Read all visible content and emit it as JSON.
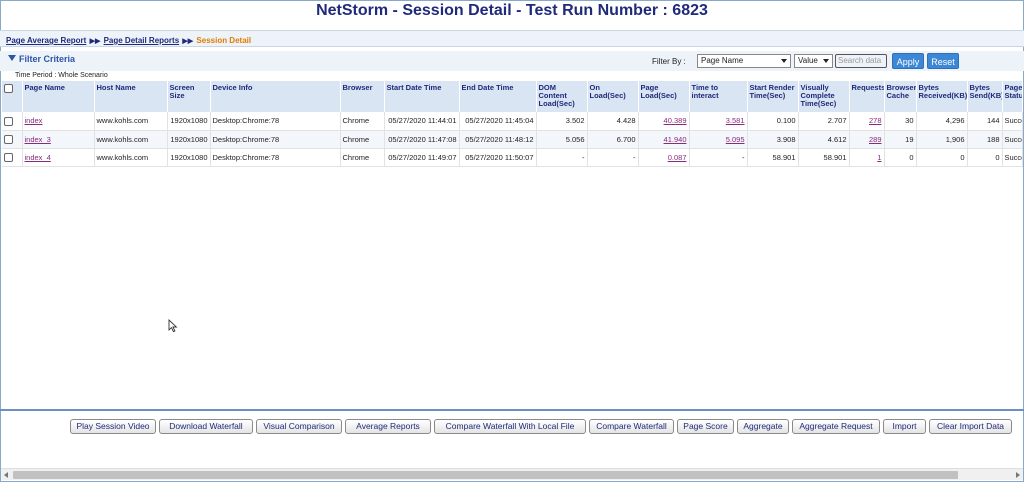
{
  "title": "NetStorm - Session Detail - Test Run Number : 6823",
  "breadcrumb": {
    "items": [
      "Page Average Report",
      "Page Detail Reports"
    ],
    "current": "Session Detail"
  },
  "filter": {
    "title": "Filter Criteria",
    "filter_by_label": "Filter By :",
    "field_select": "Page Name",
    "value_select": "Value",
    "search_placeholder": "Search data",
    "apply_label": "Apply",
    "reset_label": "Reset",
    "time_period": "Time Period : Whole Scenario"
  },
  "table": {
    "columns": [
      "Page Name",
      "Host Name",
      "Screen Size",
      "Device Info",
      "Browser",
      "Start Date Time",
      "End Date Time",
      "DOM Content Load(Sec)",
      "On Load(Sec)",
      "Page Load(Sec)",
      "Time to interact",
      "Start Render Time(Sec)",
      "Visually Complete Time(Sec)",
      "Requests",
      "Browser Cache",
      "Bytes Received(KB)",
      "Bytes Send(KB)",
      "Page Status"
    ],
    "rows": [
      [
        "index",
        "www.kohls.com",
        "1920x1080",
        "Desktop:Chrome:78",
        "Chrome",
        "05/27/2020 11:44:01",
        "05/27/2020 11:45:04",
        "3.502",
        "4.428",
        "40.389",
        "3.581",
        "0.100",
        "2.707",
        "278",
        "30",
        "4,296",
        "144",
        "Success"
      ],
      [
        "index_3",
        "www.kohls.com",
        "1920x1080",
        "Desktop:Chrome:78",
        "Chrome",
        "05/27/2020 11:47:08",
        "05/27/2020 11:48:12",
        "5.056",
        "6.700",
        "41.940",
        "5.095",
        "3.908",
        "4.612",
        "289",
        "19",
        "1,906",
        "188",
        "Success"
      ],
      [
        "index_4",
        "www.kohls.com",
        "1920x1080",
        "Desktop:Chrome:78",
        "Chrome",
        "05/27/2020 11:49:07",
        "05/27/2020 11:50:07",
        "-",
        "-",
        "0.087",
        "-",
        "58.901",
        "58.901",
        "1",
        "0",
        "0",
        "0",
        "Success"
      ]
    ]
  },
  "actions": [
    "Play Session Video",
    "Download Waterfall",
    "Visual Comparison",
    "Average Reports",
    "Compare Waterfall With Local File",
    "Compare Waterfall",
    "Page Score",
    "Aggregate",
    "Aggregate Request",
    "Import",
    "Clear Import Data"
  ]
}
